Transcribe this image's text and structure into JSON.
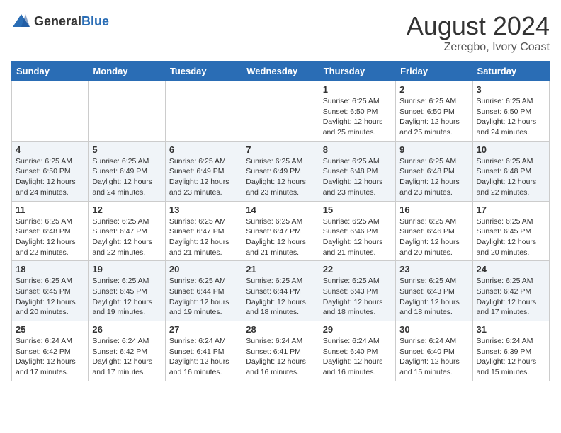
{
  "header": {
    "logo_general": "General",
    "logo_blue": "Blue",
    "title": "August 2024",
    "subtitle": "Zeregbo, Ivory Coast"
  },
  "days_of_week": [
    "Sunday",
    "Monday",
    "Tuesday",
    "Wednesday",
    "Thursday",
    "Friday",
    "Saturday"
  ],
  "weeks": [
    [
      {
        "day": "",
        "sunrise": "",
        "sunset": "",
        "daylight": ""
      },
      {
        "day": "",
        "sunrise": "",
        "sunset": "",
        "daylight": ""
      },
      {
        "day": "",
        "sunrise": "",
        "sunset": "",
        "daylight": ""
      },
      {
        "day": "",
        "sunrise": "",
        "sunset": "",
        "daylight": ""
      },
      {
        "day": "1",
        "sunrise": "Sunrise: 6:25 AM",
        "sunset": "Sunset: 6:50 PM",
        "daylight": "Daylight: 12 hours and 25 minutes."
      },
      {
        "day": "2",
        "sunrise": "Sunrise: 6:25 AM",
        "sunset": "Sunset: 6:50 PM",
        "daylight": "Daylight: 12 hours and 25 minutes."
      },
      {
        "day": "3",
        "sunrise": "Sunrise: 6:25 AM",
        "sunset": "Sunset: 6:50 PM",
        "daylight": "Daylight: 12 hours and 24 minutes."
      }
    ],
    [
      {
        "day": "4",
        "sunrise": "Sunrise: 6:25 AM",
        "sunset": "Sunset: 6:50 PM",
        "daylight": "Daylight: 12 hours and 24 minutes."
      },
      {
        "day": "5",
        "sunrise": "Sunrise: 6:25 AM",
        "sunset": "Sunset: 6:49 PM",
        "daylight": "Daylight: 12 hours and 24 minutes."
      },
      {
        "day": "6",
        "sunrise": "Sunrise: 6:25 AM",
        "sunset": "Sunset: 6:49 PM",
        "daylight": "Daylight: 12 hours and 23 minutes."
      },
      {
        "day": "7",
        "sunrise": "Sunrise: 6:25 AM",
        "sunset": "Sunset: 6:49 PM",
        "daylight": "Daylight: 12 hours and 23 minutes."
      },
      {
        "day": "8",
        "sunrise": "Sunrise: 6:25 AM",
        "sunset": "Sunset: 6:48 PM",
        "daylight": "Daylight: 12 hours and 23 minutes."
      },
      {
        "day": "9",
        "sunrise": "Sunrise: 6:25 AM",
        "sunset": "Sunset: 6:48 PM",
        "daylight": "Daylight: 12 hours and 23 minutes."
      },
      {
        "day": "10",
        "sunrise": "Sunrise: 6:25 AM",
        "sunset": "Sunset: 6:48 PM",
        "daylight": "Daylight: 12 hours and 22 minutes."
      }
    ],
    [
      {
        "day": "11",
        "sunrise": "Sunrise: 6:25 AM",
        "sunset": "Sunset: 6:48 PM",
        "daylight": "Daylight: 12 hours and 22 minutes."
      },
      {
        "day": "12",
        "sunrise": "Sunrise: 6:25 AM",
        "sunset": "Sunset: 6:47 PM",
        "daylight": "Daylight: 12 hours and 22 minutes."
      },
      {
        "day": "13",
        "sunrise": "Sunrise: 6:25 AM",
        "sunset": "Sunset: 6:47 PM",
        "daylight": "Daylight: 12 hours and 21 minutes."
      },
      {
        "day": "14",
        "sunrise": "Sunrise: 6:25 AM",
        "sunset": "Sunset: 6:47 PM",
        "daylight": "Daylight: 12 hours and 21 minutes."
      },
      {
        "day": "15",
        "sunrise": "Sunrise: 6:25 AM",
        "sunset": "Sunset: 6:46 PM",
        "daylight": "Daylight: 12 hours and 21 minutes."
      },
      {
        "day": "16",
        "sunrise": "Sunrise: 6:25 AM",
        "sunset": "Sunset: 6:46 PM",
        "daylight": "Daylight: 12 hours and 20 minutes."
      },
      {
        "day": "17",
        "sunrise": "Sunrise: 6:25 AM",
        "sunset": "Sunset: 6:45 PM",
        "daylight": "Daylight: 12 hours and 20 minutes."
      }
    ],
    [
      {
        "day": "18",
        "sunrise": "Sunrise: 6:25 AM",
        "sunset": "Sunset: 6:45 PM",
        "daylight": "Daylight: 12 hours and 20 minutes."
      },
      {
        "day": "19",
        "sunrise": "Sunrise: 6:25 AM",
        "sunset": "Sunset: 6:45 PM",
        "daylight": "Daylight: 12 hours and 19 minutes."
      },
      {
        "day": "20",
        "sunrise": "Sunrise: 6:25 AM",
        "sunset": "Sunset: 6:44 PM",
        "daylight": "Daylight: 12 hours and 19 minutes."
      },
      {
        "day": "21",
        "sunrise": "Sunrise: 6:25 AM",
        "sunset": "Sunset: 6:44 PM",
        "daylight": "Daylight: 12 hours and 18 minutes."
      },
      {
        "day": "22",
        "sunrise": "Sunrise: 6:25 AM",
        "sunset": "Sunset: 6:43 PM",
        "daylight": "Daylight: 12 hours and 18 minutes."
      },
      {
        "day": "23",
        "sunrise": "Sunrise: 6:25 AM",
        "sunset": "Sunset: 6:43 PM",
        "daylight": "Daylight: 12 hours and 18 minutes."
      },
      {
        "day": "24",
        "sunrise": "Sunrise: 6:25 AM",
        "sunset": "Sunset: 6:42 PM",
        "daylight": "Daylight: 12 hours and 17 minutes."
      }
    ],
    [
      {
        "day": "25",
        "sunrise": "Sunrise: 6:24 AM",
        "sunset": "Sunset: 6:42 PM",
        "daylight": "Daylight: 12 hours and 17 minutes."
      },
      {
        "day": "26",
        "sunrise": "Sunrise: 6:24 AM",
        "sunset": "Sunset: 6:42 PM",
        "daylight": "Daylight: 12 hours and 17 minutes."
      },
      {
        "day": "27",
        "sunrise": "Sunrise: 6:24 AM",
        "sunset": "Sunset: 6:41 PM",
        "daylight": "Daylight: 12 hours and 16 minutes."
      },
      {
        "day": "28",
        "sunrise": "Sunrise: 6:24 AM",
        "sunset": "Sunset: 6:41 PM",
        "daylight": "Daylight: 12 hours and 16 minutes."
      },
      {
        "day": "29",
        "sunrise": "Sunrise: 6:24 AM",
        "sunset": "Sunset: 6:40 PM",
        "daylight": "Daylight: 12 hours and 16 minutes."
      },
      {
        "day": "30",
        "sunrise": "Sunrise: 6:24 AM",
        "sunset": "Sunset: 6:40 PM",
        "daylight": "Daylight: 12 hours and 15 minutes."
      },
      {
        "day": "31",
        "sunrise": "Sunrise: 6:24 AM",
        "sunset": "Sunset: 6:39 PM",
        "daylight": "Daylight: 12 hours and 15 minutes."
      }
    ]
  ]
}
